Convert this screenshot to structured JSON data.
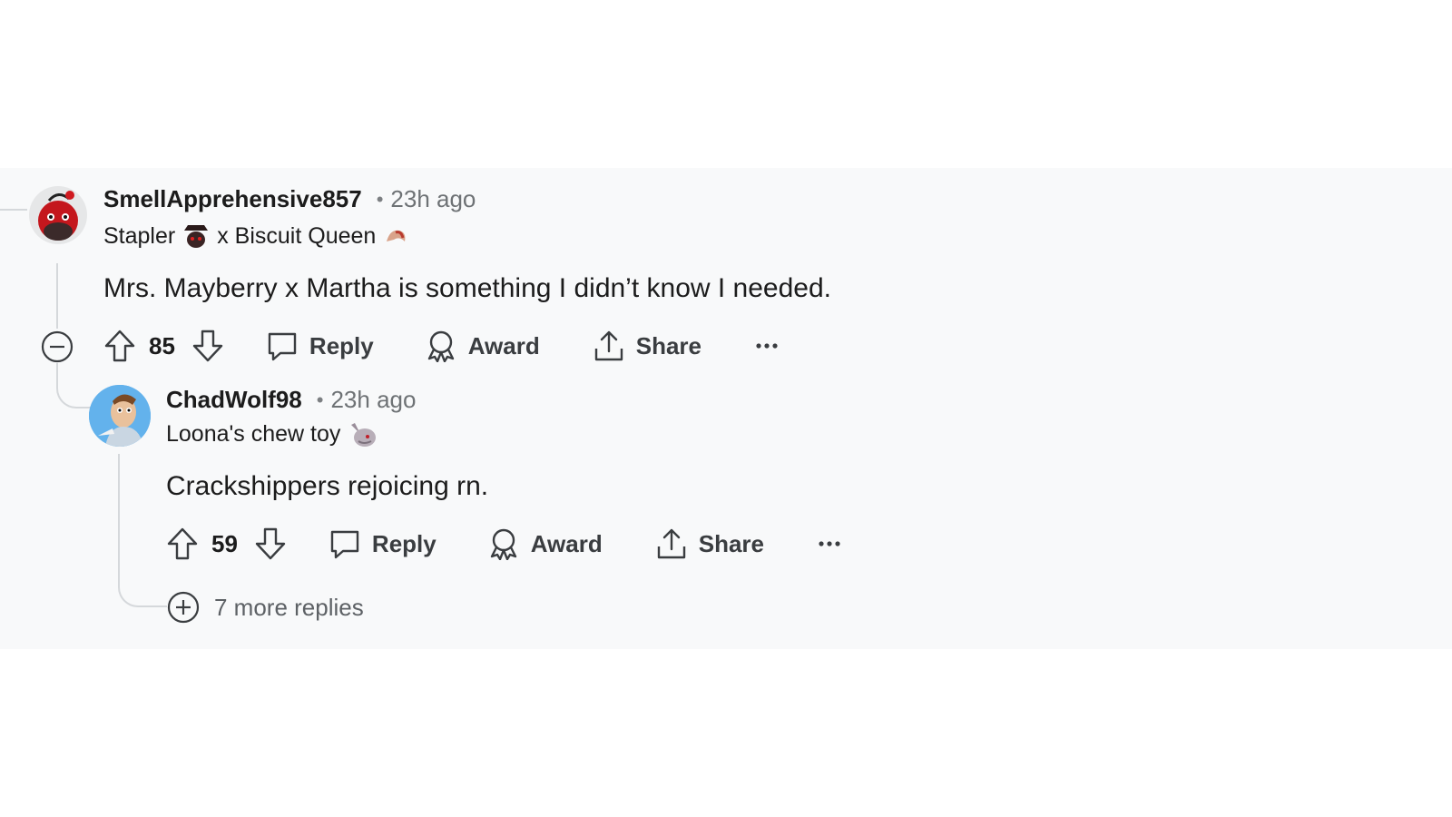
{
  "comments": [
    {
      "username": "SmellApprehensive857",
      "separator": "•",
      "time": "23h ago",
      "flair": {
        "part1": "Stapler",
        "part2": "x Biscuit Queen"
      },
      "body": "Mrs. Mayberry x Martha is something I didn’t know I needed.",
      "votes": "85",
      "actions": {
        "reply": "Reply",
        "award": "Award",
        "share": "Share"
      }
    },
    {
      "username": "ChadWolf98",
      "separator": "•",
      "time": "23h ago",
      "flair": {
        "part1": "Loona's chew toy"
      },
      "body": "Crackshippers rejoicing rn.",
      "votes": "59",
      "actions": {
        "reply": "Reply",
        "award": "Award",
        "share": "Share"
      }
    }
  ],
  "more_replies": "7 more replies",
  "colors": {
    "panel_bg": "#f8f9fa",
    "thread_line": "#d5d8db",
    "text": "#1c1c1c",
    "muted": "#6e7275"
  },
  "icons": [
    "collapse-icon",
    "upvote-icon",
    "downvote-icon",
    "reply-icon",
    "award-icon",
    "share-icon",
    "more-options-icon",
    "expand-icon"
  ]
}
